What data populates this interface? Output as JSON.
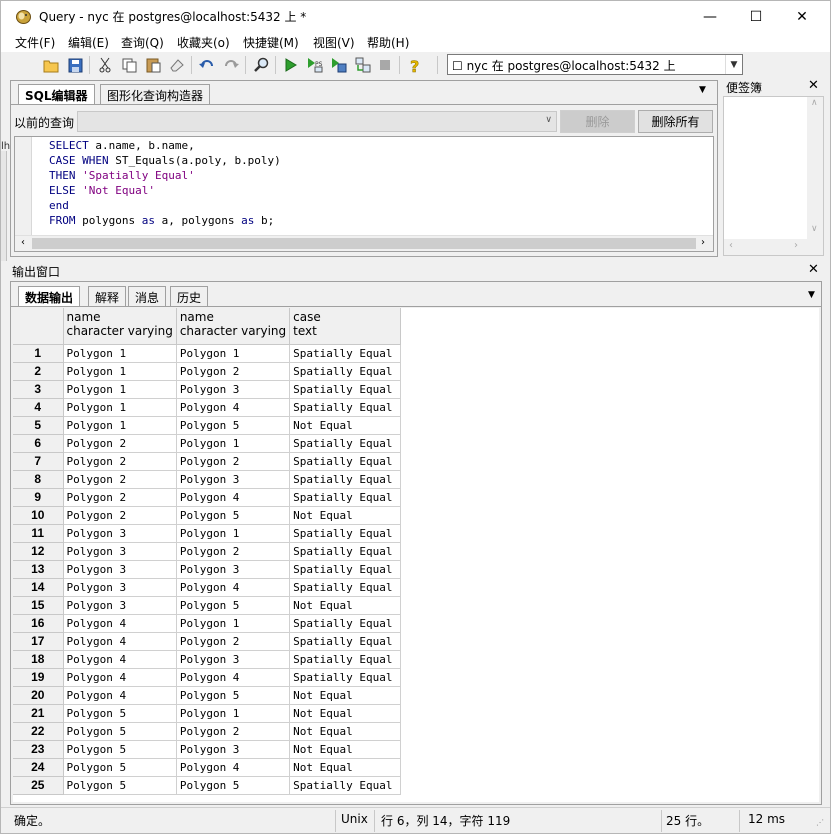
{
  "window": {
    "title": "Query - nyc 在  postgres@localhost:5432 上 *",
    "minimize": "—",
    "maximize": "☐",
    "close": "✕"
  },
  "menu": [
    "文件(F)",
    "编辑(E)",
    "查询(Q)",
    "收藏夹(o)",
    "快捷键(M)",
    "视图(V)",
    "帮助(H)"
  ],
  "toolbar": {
    "icons": [
      "open-icon",
      "save-icon",
      "cut-icon",
      "copy-icon",
      "paste-icon",
      "clear-icon",
      "undo-icon",
      "redo-icon",
      "find-icon",
      "execute-icon",
      "explain-icon",
      "execute-file-icon",
      "pgscript-icon",
      "stop-icon",
      "help-icon"
    ],
    "db_selector": "☐ nyc 在  postgres@localhost:5432 上"
  },
  "sql_panel": {
    "tabs": [
      "SQL编辑器",
      "图形化查询构造器"
    ],
    "previous_label": "以前的查询",
    "delete_button": "删除",
    "delete_all_button": "删除所有",
    "code_lines": [
      [
        [
          "kw",
          "SELECT "
        ],
        [
          "t",
          "a.name, b.name,"
        ]
      ],
      [
        [
          "kw",
          "CASE WHEN "
        ],
        [
          "t",
          "ST_Equals(a.poly, b.poly)"
        ]
      ],
      [
        [
          "kw",
          "THEN "
        ],
        [
          "str",
          "'Spatially Equal'"
        ]
      ],
      [
        [
          "kw",
          "ELSE "
        ],
        [
          "str",
          "'Not Equal'"
        ]
      ],
      [
        [
          "kw",
          "end"
        ]
      ],
      [
        [
          "kw",
          "FROM "
        ],
        [
          "t",
          "polygons "
        ],
        [
          "kw",
          "as "
        ],
        [
          "t",
          "a, polygons "
        ],
        [
          "kw",
          "as "
        ],
        [
          "t",
          "b;"
        ]
      ]
    ]
  },
  "scratch_pad": {
    "title": "便签簿",
    "close": "✕"
  },
  "output": {
    "title": "输出窗口",
    "close": "✕",
    "tabs": [
      "数据输出",
      "解释",
      "消息",
      "历史"
    ],
    "columns": [
      {
        "name": "name",
        "type": "character varying"
      },
      {
        "name": "name",
        "type": "character varying"
      },
      {
        "name": "case",
        "type": "text"
      }
    ],
    "rows": [
      [
        "1",
        "Polygon 1",
        "Polygon 1",
        "Spatially Equal"
      ],
      [
        "2",
        "Polygon 1",
        "Polygon 2",
        "Spatially Equal"
      ],
      [
        "3",
        "Polygon 1",
        "Polygon 3",
        "Spatially Equal"
      ],
      [
        "4",
        "Polygon 1",
        "Polygon 4",
        "Spatially Equal"
      ],
      [
        "5",
        "Polygon 1",
        "Polygon 5",
        "Not Equal"
      ],
      [
        "6",
        "Polygon 2",
        "Polygon 1",
        "Spatially Equal"
      ],
      [
        "7",
        "Polygon 2",
        "Polygon 2",
        "Spatially Equal"
      ],
      [
        "8",
        "Polygon 2",
        "Polygon 3",
        "Spatially Equal"
      ],
      [
        "9",
        "Polygon 2",
        "Polygon 4",
        "Spatially Equal"
      ],
      [
        "10",
        "Polygon 2",
        "Polygon 5",
        "Not Equal"
      ],
      [
        "11",
        "Polygon 3",
        "Polygon 1",
        "Spatially Equal"
      ],
      [
        "12",
        "Polygon 3",
        "Polygon 2",
        "Spatially Equal"
      ],
      [
        "13",
        "Polygon 3",
        "Polygon 3",
        "Spatially Equal"
      ],
      [
        "14",
        "Polygon 3",
        "Polygon 4",
        "Spatially Equal"
      ],
      [
        "15",
        "Polygon 3",
        "Polygon 5",
        "Not Equal"
      ],
      [
        "16",
        "Polygon 4",
        "Polygon 1",
        "Spatially Equal"
      ],
      [
        "17",
        "Polygon 4",
        "Polygon 2",
        "Spatially Equal"
      ],
      [
        "18",
        "Polygon 4",
        "Polygon 3",
        "Spatially Equal"
      ],
      [
        "19",
        "Polygon 4",
        "Polygon 4",
        "Spatially Equal"
      ],
      [
        "20",
        "Polygon 4",
        "Polygon 5",
        "Not Equal"
      ],
      [
        "21",
        "Polygon 5",
        "Polygon 1",
        "Not Equal"
      ],
      [
        "22",
        "Polygon 5",
        "Polygon 2",
        "Not Equal"
      ],
      [
        "23",
        "Polygon 5",
        "Polygon 3",
        "Not Equal"
      ],
      [
        "24",
        "Polygon 5",
        "Polygon 4",
        "Not Equal"
      ],
      [
        "25",
        "Polygon 5",
        "Polygon 5",
        "Spatially Equal"
      ]
    ]
  },
  "status": {
    "ok": "确定。",
    "line_ending": "Unix",
    "position": "行 6，列 14，字符 119",
    "rows": "25 行。",
    "time": "12 ms"
  },
  "colors": {
    "keyword": "#000080",
    "string": "#800080"
  }
}
